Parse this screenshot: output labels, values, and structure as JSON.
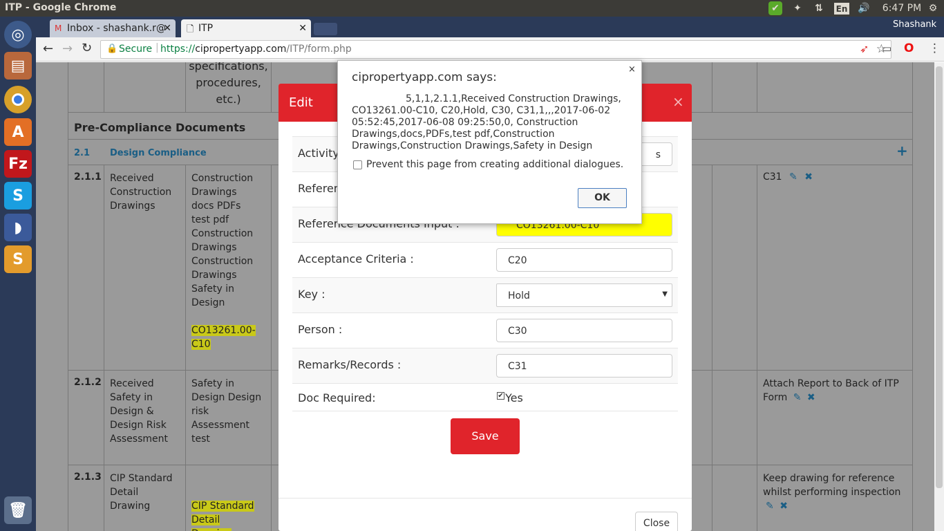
{
  "os": {
    "window_title": "ITP - Google Chrome",
    "lang": "En",
    "time": "6:47 PM",
    "user": "Shashank"
  },
  "browser": {
    "tabs": [
      {
        "label": "Inbox - shashank.r@"
      },
      {
        "label": "ITP"
      }
    ],
    "secure_label": "Secure",
    "url_scheme": "https://",
    "url_host": "cipropertyapp.com",
    "url_path": "/ITP/form.php"
  },
  "table": {
    "header_fragment": [
      "specifications,",
      "procedures,",
      "etc.)"
    ],
    "section_title": "Pre-Compliance Documents",
    "subsection": {
      "num": "2.1",
      "name": "Design Compliance"
    },
    "rows": [
      {
        "num": "2.1.1",
        "activity": "Received Construction Drawings",
        "docs": "Construction Drawings docs PDFs test pdf Construction Drawings Construction Drawings Safety in Design",
        "doc_highlight": "CO13261.00-C10",
        "remarks": "C31"
      },
      {
        "num": "2.1.2",
        "activity": "Received Safety in Design & Design Risk Assessment",
        "docs": "Safety in Design Design risk Assessment test",
        "doc_highlight": "",
        "remarks": "Attach Report to Back of ITP Form"
      },
      {
        "num": "2.1.3",
        "activity": "CIP Standard Detail Drawing",
        "docs": "",
        "doc_highlight": "CIP Standard Detail Drawing",
        "remarks": "Keep drawing for reference whilst performing inspection"
      }
    ]
  },
  "modal": {
    "title": "Edit",
    "close_x": "×",
    "fields": [
      {
        "label": "Activity :",
        "value": "s"
      },
      {
        "label": "Reference",
        "value": ""
      },
      {
        "label": "Reference Documents Input :",
        "value": "CO13261.00-C10"
      },
      {
        "label": "Acceptance Criteria :",
        "value": "C20"
      },
      {
        "label": "Key :",
        "value": "Hold"
      },
      {
        "label": "Person :",
        "value": "C30"
      },
      {
        "label": "Remarks/Records :",
        "value": "C31"
      }
    ],
    "doc_required": {
      "label": "Doc Required:",
      "value": "Yes",
      "checked": true
    },
    "save_label": "Save",
    "close_label": "Close"
  },
  "alert": {
    "title": "cipropertyapp.com says:",
    "message": "5,1,1,2.1.1,Received Construction Drawings, CO13261.00-C10, C20,Hold, C30, C31,1,,,2017-06-02 05:52:45,2017-06-08 09:25:50,0, Construction Drawings,docs,PDFs,test pdf,Construction Drawings,Construction Drawings,Safety in Design",
    "prevent_label": "Prevent this page from creating additional dialogues.",
    "ok_label": "OK",
    "close_x": "×"
  },
  "colors": {
    "modal_red": "#e0242b",
    "highlight": "#ffff00",
    "link_blue": "#2a8fcf"
  }
}
